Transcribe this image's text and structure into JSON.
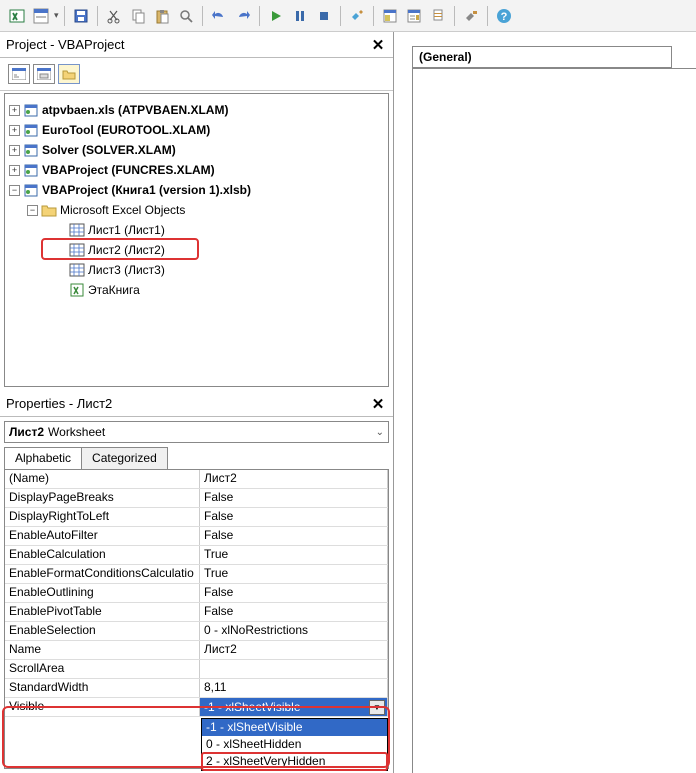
{
  "toolbar_icons": [
    "excel",
    "form",
    "save",
    "cut",
    "copy",
    "paste",
    "brush",
    "undo",
    "redo",
    "run",
    "pause",
    "stop",
    "mode",
    "window1",
    "window2",
    "window3",
    "toolbox",
    "help"
  ],
  "project_panel": {
    "title": "Project - VBAProject"
  },
  "tree": {
    "nodes": [
      {
        "label": "atpvbaen.xls (ATPVBAEN.XLAM)",
        "bold": true,
        "indent": 0,
        "expander": "+",
        "icon": "book"
      },
      {
        "label": "EuroTool (EUROTOOL.XLAM)",
        "bold": true,
        "indent": 0,
        "expander": "+",
        "icon": "book"
      },
      {
        "label": "Solver (SOLVER.XLAM)",
        "bold": true,
        "indent": 0,
        "expander": "+",
        "icon": "book"
      },
      {
        "label": "VBAProject (FUNCRES.XLAM)",
        "bold": true,
        "indent": 0,
        "expander": "+",
        "icon": "book"
      },
      {
        "label": "VBAProject (Книга1 (version 1).xlsb)",
        "bold": true,
        "indent": 0,
        "expander": "−",
        "icon": "book"
      },
      {
        "label": "Microsoft Excel Objects",
        "bold": false,
        "indent": 1,
        "expander": "−",
        "icon": "folder"
      },
      {
        "label": "Лист1 (Лист1)",
        "bold": false,
        "indent": 2,
        "expander": "",
        "icon": "sheet"
      },
      {
        "label": "Лист2 (Лист2)",
        "bold": false,
        "indent": 2,
        "expander": "",
        "icon": "sheet",
        "highlight": true
      },
      {
        "label": "Лист3 (Лист3)",
        "bold": false,
        "indent": 2,
        "expander": "",
        "icon": "sheet"
      },
      {
        "label": "ЭтаКнига",
        "bold": false,
        "indent": 2,
        "expander": "",
        "icon": "workbook"
      }
    ]
  },
  "properties_panel": {
    "title": "Properties - Лист2",
    "object_name": "Лист2",
    "object_type": "Worksheet",
    "tabs": {
      "alphabetic": "Alphabetic",
      "categorized": "Categorized"
    },
    "rows": [
      {
        "name": "(Name)",
        "value": "Лист2"
      },
      {
        "name": "DisplayPageBreaks",
        "value": "False"
      },
      {
        "name": "DisplayRightToLeft",
        "value": "False"
      },
      {
        "name": "EnableAutoFilter",
        "value": "False"
      },
      {
        "name": "EnableCalculation",
        "value": "True"
      },
      {
        "name": "EnableFormatConditionsCalculatio",
        "value": "True"
      },
      {
        "name": "EnableOutlining",
        "value": "False"
      },
      {
        "name": "EnablePivotTable",
        "value": "False"
      },
      {
        "name": "EnableSelection",
        "value": "0 - xlNoRestrictions"
      },
      {
        "name": "Name",
        "value": "Лист2"
      },
      {
        "name": "ScrollArea",
        "value": ""
      },
      {
        "name": "StandardWidth",
        "value": "8,11"
      },
      {
        "name": "Visible",
        "value": "-1 - xlSheetVisible",
        "selected": true
      }
    ],
    "dropdown": [
      {
        "label": "-1 - xlSheetVisible",
        "selected": true
      },
      {
        "label": "0 - xlSheetHidden"
      },
      {
        "label": "2 - xlSheetVeryHidden",
        "boxed": true
      }
    ]
  },
  "code_pane": {
    "scope": "(General)"
  }
}
